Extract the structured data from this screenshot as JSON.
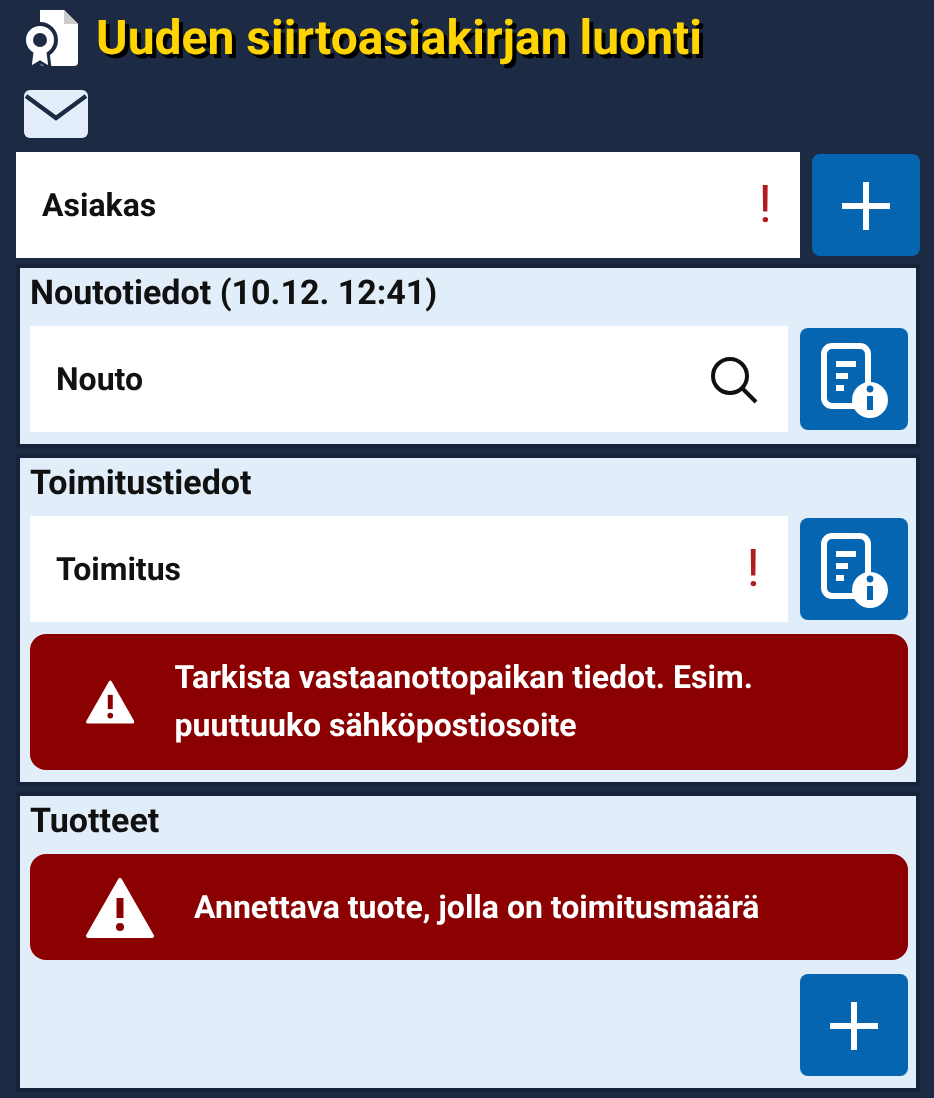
{
  "title": "Uuden siirtoasiakirjan luonti",
  "customer": {
    "label": "Asiakas",
    "indicator": {
      "kind": "required",
      "text": "!"
    },
    "button": {
      "kind": "add"
    }
  },
  "sections": [
    {
      "heading": "Noutotiedot (10.12. 12:41)",
      "items": [
        {
          "kind": "field",
          "label": "Nouto",
          "indicator": {
            "kind": "search"
          },
          "button": {
            "kind": "info"
          }
        }
      ]
    },
    {
      "heading": "Toimitustiedot",
      "items": [
        {
          "kind": "field",
          "label": "Toimitus",
          "indicator": {
            "kind": "required",
            "text": "!"
          },
          "button": {
            "kind": "info"
          }
        },
        {
          "kind": "alert",
          "text": "Tarkista vastaanottopaikan tiedot. Esim. puuttuuko sähköpostiosoite"
        }
      ]
    },
    {
      "heading": "Tuotteet",
      "items": [
        {
          "kind": "alert",
          "text": "Annettava tuote, jolla on toimitusmäärä"
        },
        {
          "kind": "add"
        }
      ]
    }
  ]
}
